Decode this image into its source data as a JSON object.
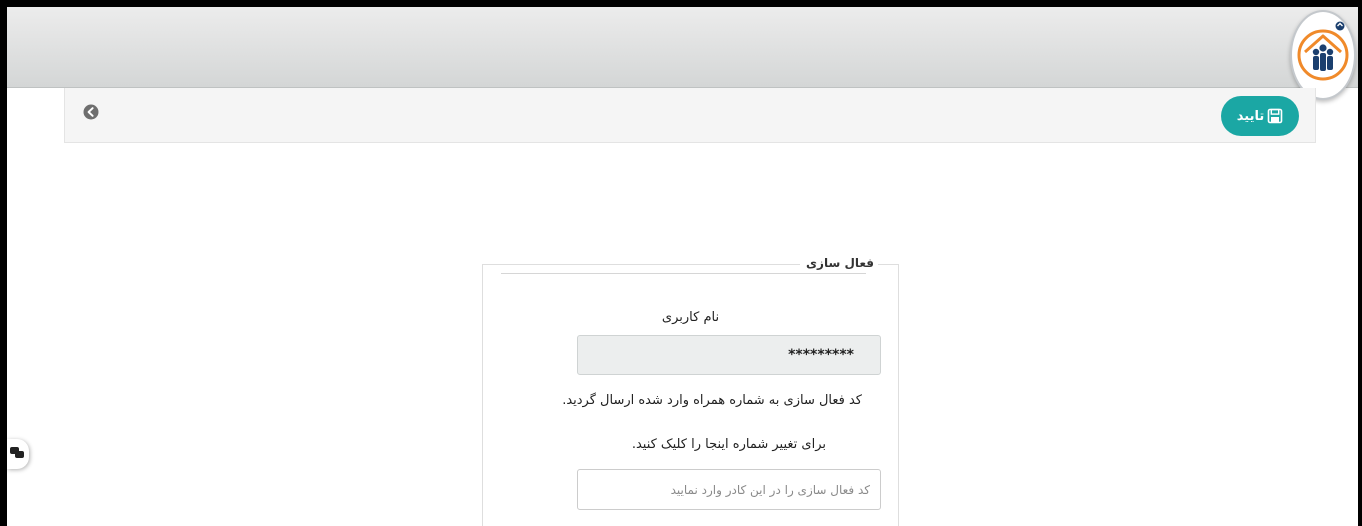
{
  "toolbar": {
    "confirm_label": "تایید",
    "confirm_icon": "floppy-disk-icon",
    "back_icon": "circle-arrow-left-icon"
  },
  "form": {
    "legend": "فعال سازی",
    "username_label": "نام کاربری",
    "username_value": "*********",
    "info_text": "کد فعال سازی به شماره همراه وارد شده ارسال گردید.",
    "change_number_text": "برای تغییر شماره اینجا را کلیک کنید.",
    "code_placeholder": "کد فعال سازی را در این کادر وارد نمایید"
  },
  "colors": {
    "accent": "#1ba7a4",
    "header_gradient_top": "#ececec",
    "header_gradient_bottom": "#d4d6d6"
  }
}
